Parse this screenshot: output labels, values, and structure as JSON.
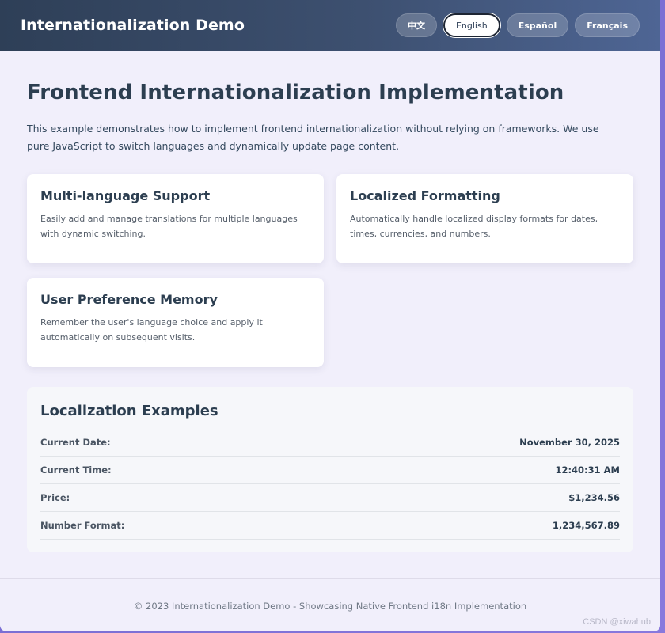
{
  "header": {
    "title": "Internationalization Demo",
    "languages": [
      {
        "label": "中文"
      },
      {
        "label": "English",
        "active": true
      },
      {
        "label": "Español"
      },
      {
        "label": "Français"
      }
    ]
  },
  "main": {
    "title": "Frontend Internationalization Implementation",
    "intro": "This example demonstrates how to implement frontend internationalization without relying on frameworks. We use pure JavaScript to switch languages and dynamically update page content.",
    "features": [
      {
        "title": "Multi-language Support",
        "desc": "Easily add and manage translations for multiple languages with dynamic switching."
      },
      {
        "title": "Localized Formatting",
        "desc": "Automatically handle localized display formats for dates, times, currencies, and numbers."
      },
      {
        "title": "User Preference Memory",
        "desc": "Remember the user's language choice and apply it automatically on subsequent visits."
      }
    ],
    "examples": {
      "title": "Localization Examples",
      "rows": [
        {
          "label": "Current Date:",
          "value": "November 30, 2025"
        },
        {
          "label": "Current Time:",
          "value": "12:40:31 AM"
        },
        {
          "label": "Price:",
          "value": "$1,234.56"
        },
        {
          "label": "Number Format:",
          "value": "1,234,567.89"
        }
      ]
    }
  },
  "footer": {
    "text": "© 2023 Internationalization Demo - Showcasing Native Frontend i18n Implementation"
  },
  "watermark": "CSDN @xiwahub"
}
